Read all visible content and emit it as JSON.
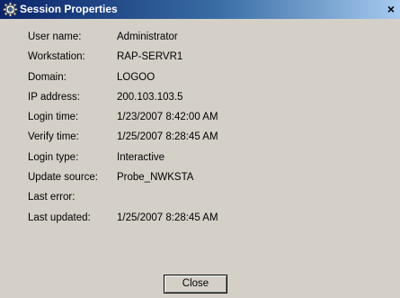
{
  "window": {
    "title": "Session Properties",
    "title_icon": "gear-icon",
    "close_glyph": "×",
    "colors": {
      "titlebar_start": "#0a246a",
      "titlebar_end": "#a6caf0",
      "face": "#d4d0c8"
    }
  },
  "properties": [
    {
      "label": "User name:",
      "value": "Administrator"
    },
    {
      "label": "Workstation:",
      "value": "RAP-SERVR1"
    },
    {
      "label": "Domain:",
      "value": "LOGOO"
    },
    {
      "label": "IP address:",
      "value": "200.103.103.5"
    },
    {
      "label": "Login time:",
      "value": "1/23/2007 8:42:00 AM"
    },
    {
      "label": "Verify time:",
      "value": "1/25/2007 8:28:45 AM"
    },
    {
      "label": "Login type:",
      "value": "Interactive"
    },
    {
      "label": "Update source:",
      "value": "Probe_NWKSTA"
    },
    {
      "label": "Last error:",
      "value": ""
    },
    {
      "label": "Last updated:",
      "value": "1/25/2007 8:28:45 AM"
    }
  ],
  "buttons": {
    "close_label": "Close"
  }
}
